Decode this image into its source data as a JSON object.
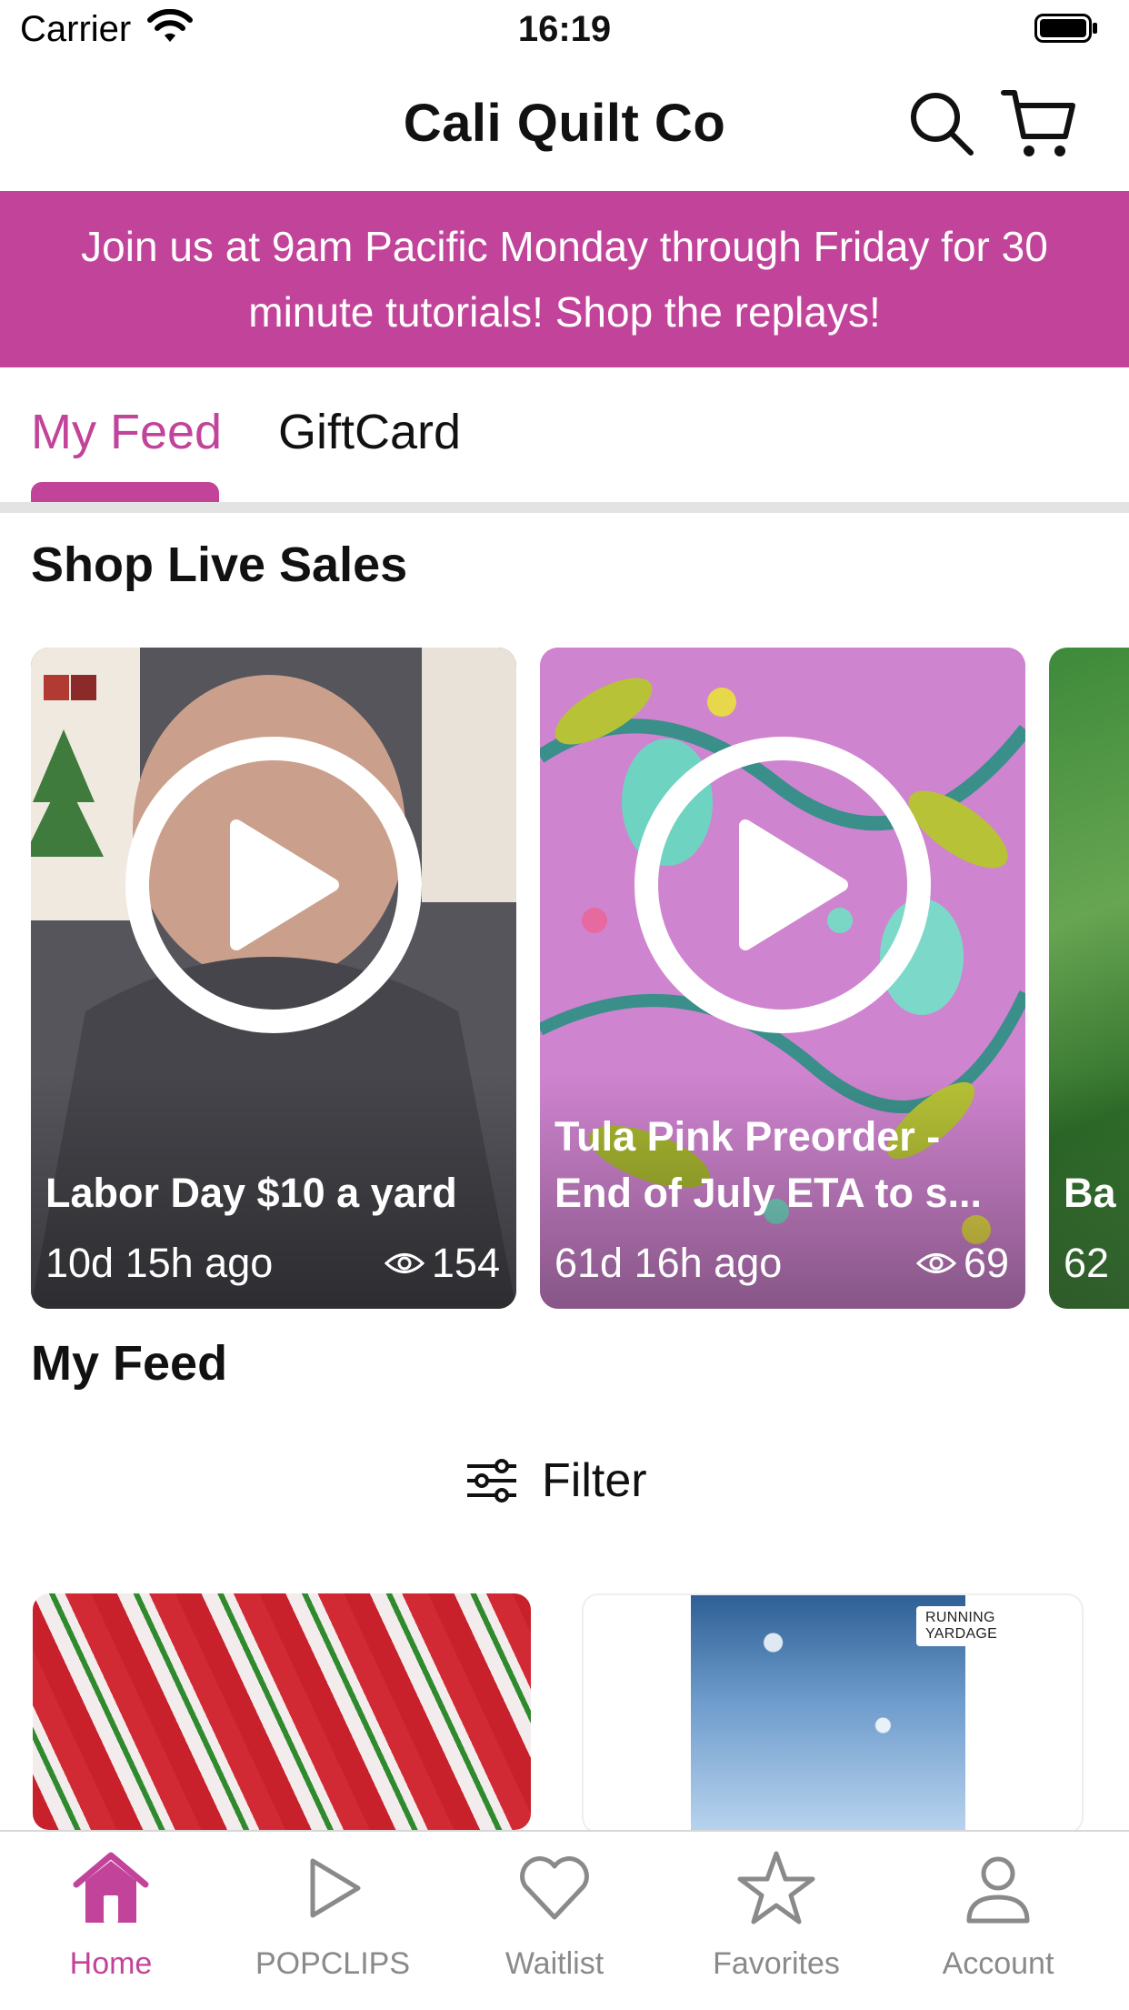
{
  "status_bar": {
    "carrier": "Carrier",
    "time": "16:19"
  },
  "nav": {
    "title": "Cali Quilt Co",
    "search_icon": "search-icon",
    "cart_icon": "cart-icon"
  },
  "promo": {
    "text": "Join us at 9am Pacific Monday through Friday for 30 minute tutorials!  Shop the replays!",
    "color": "#c2449a"
  },
  "tabs": [
    {
      "label": "My Feed",
      "active": true
    },
    {
      "label": "GiftCard",
      "active": false
    }
  ],
  "live_sales": {
    "heading": "Shop Live Sales",
    "cards": [
      {
        "title": "Labor Day $10 a yard",
        "age": "10d 15h ago",
        "views": "154"
      },
      {
        "title": "Tula Pink Preorder - End of July ETA to s...",
        "age": "61d 16h ago",
        "views": "69"
      },
      {
        "title": "Ba",
        "age": "62"
      }
    ]
  },
  "feed": {
    "heading": "My Feed",
    "filter_label": "Filter",
    "products": [
      {
        "tag": ""
      },
      {
        "tag": "RUNNING YARDAGE"
      }
    ]
  },
  "tabbar": {
    "items": [
      {
        "label": "Home",
        "icon": "home-icon",
        "active": true
      },
      {
        "label": "POPCLIPS",
        "icon": "play-icon",
        "active": false
      },
      {
        "label": "Waitlist",
        "icon": "heart-icon",
        "active": false
      },
      {
        "label": "Favorites",
        "icon": "star-icon",
        "active": false
      },
      {
        "label": "Account",
        "icon": "person-icon",
        "active": false
      }
    ]
  },
  "colors": {
    "accent": "#c2449a",
    "inactive": "#8a8a8a"
  }
}
